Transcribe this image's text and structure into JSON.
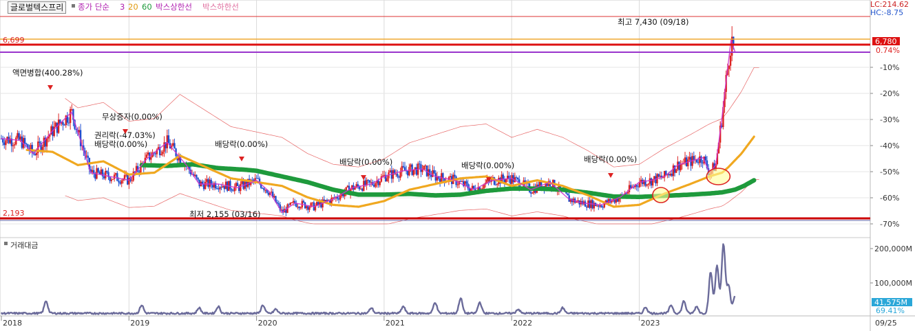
{
  "header": {
    "stock_name": "글로벌텍스프리",
    "ma_label": "종가 단순",
    "ma_periods": [
      "3",
      "20",
      "60"
    ],
    "box_upper": "박스상한선",
    "box_lower": "박스하한선",
    "lc": "LC:214.62",
    "hc": "HC:-8.75"
  },
  "colors": {
    "ma3": "#cc33cc",
    "ma20": "#f0a820",
    "ma60": "#1e9a3c",
    "box_upper": "#dd2222",
    "box_lower": "#ee88aa",
    "candle_up": "#dd2222",
    "candle_down": "#1f4fcf",
    "volume": "#6b6b9a"
  },
  "chart_data": {
    "type": "line",
    "title": "글로벌텍스프리",
    "x": [
      "2018",
      "2019",
      "2020",
      "2021",
      "2022",
      "2023",
      "09/25"
    ],
    "ylim": [
      2000,
      7700
    ],
    "right_axis_ticks": [
      "-10%",
      "-20%",
      "-30%",
      "-40%",
      "-50%",
      "-60%",
      "-70%"
    ],
    "series": [
      {
        "name": "종가 단순 3",
        "x": [
          2018.0,
          2018.15,
          2018.25,
          2018.4,
          2018.55,
          2018.7,
          2018.85,
          2019.0,
          2019.15,
          2019.3,
          2019.45,
          2019.55,
          2019.7,
          2019.85,
          2020.0,
          2020.1,
          2020.2,
          2020.3,
          2020.45,
          2020.6,
          2020.75,
          2020.9,
          2021.0,
          2021.15,
          2021.3,
          2021.4,
          2021.55,
          2021.7,
          2021.85,
          2022.0,
          2022.15,
          2022.3,
          2022.45,
          2022.55,
          2022.7,
          2022.85,
          2023.0,
          2023.1,
          2023.2,
          2023.3,
          2023.4,
          2023.5,
          2023.55,
          2023.6,
          2023.65,
          2023.68,
          2023.72,
          2023.75
        ],
        "values": [
          4300,
          4250,
          3900,
          4500,
          5000,
          3400,
          3300,
          3200,
          3800,
          4200,
          3600,
          3100,
          3100,
          3000,
          3200,
          2900,
          2350,
          2600,
          2500,
          2700,
          3000,
          3100,
          3300,
          3450,
          3500,
          3300,
          3200,
          2950,
          3200,
          3250,
          2950,
          3150,
          2700,
          2600,
          2550,
          2750,
          3150,
          3200,
          3300,
          3600,
          3700,
          3800,
          3400,
          3600,
          4900,
          5800,
          6900,
          6600
        ]
      },
      {
        "name": "종가 단순 20",
        "x": [
          2018.2,
          2018.4,
          2018.6,
          2018.8,
          2019.0,
          2019.2,
          2019.4,
          2019.6,
          2019.8,
          2020.0,
          2020.2,
          2020.4,
          2020.6,
          2020.8,
          2021.0,
          2021.2,
          2021.4,
          2021.6,
          2021.8,
          2022.0,
          2022.2,
          2022.4,
          2022.6,
          2022.8,
          2023.0,
          2023.2,
          2023.4,
          2023.55,
          2023.65,
          2023.7,
          2023.8,
          2023.9
        ],
        "values": [
          4000,
          3950,
          3600,
          3700,
          3350,
          3400,
          3850,
          3550,
          3250,
          3150,
          3050,
          2750,
          2550,
          2500,
          2650,
          2950,
          3100,
          3250,
          3300,
          3050,
          3200,
          3050,
          2800,
          2500,
          2550,
          2850,
          3100,
          3300,
          3400,
          3550,
          3900,
          4350
        ]
      },
      {
        "name": "종가 단순 60",
        "x": [
          2019.1,
          2019.3,
          2019.5,
          2019.7,
          2019.9,
          2020.0,
          2020.2,
          2020.4,
          2020.6,
          2020.8,
          2021.0,
          2021.2,
          2021.4,
          2021.6,
          2021.8,
          2022.0,
          2022.2,
          2022.4,
          2022.6,
          2022.8,
          2023.0,
          2023.2,
          2023.4,
          2023.55,
          2023.65,
          2023.75,
          2023.82,
          2023.9
        ],
        "values": [
          3600,
          3580,
          3620,
          3520,
          3480,
          3450,
          3300,
          3150,
          2950,
          2820,
          2820,
          2840,
          2800,
          2820,
          2920,
          2980,
          2980,
          2950,
          2870,
          2770,
          2760,
          2790,
          2820,
          2850,
          2880,
          2950,
          3050,
          3200
        ]
      }
    ],
    "volume": {
      "name": "거래대금",
      "unit": "M",
      "axis_ticks": [
        "200,000M",
        "100,000M"
      ],
      "last": "41,575M",
      "last_pct": "69.41%"
    },
    "price_levels": {
      "box_upper_label": "6,699",
      "box_lower_label": "2,193",
      "current_label": "6,780",
      "current_pct": "0.74%"
    },
    "annotations": [
      "액면병합(400.28%)",
      "무상증자(0.00%)",
      "권리락(-47.03%)",
      "배당락(0.00%)",
      "배당락(0.00%)",
      "배당락(0.00%)",
      "배당락(0.00%)",
      "배당락(0.00%)",
      "최고 7,430 (09/18)",
      "최저 2,155 (03/16)"
    ]
  }
}
